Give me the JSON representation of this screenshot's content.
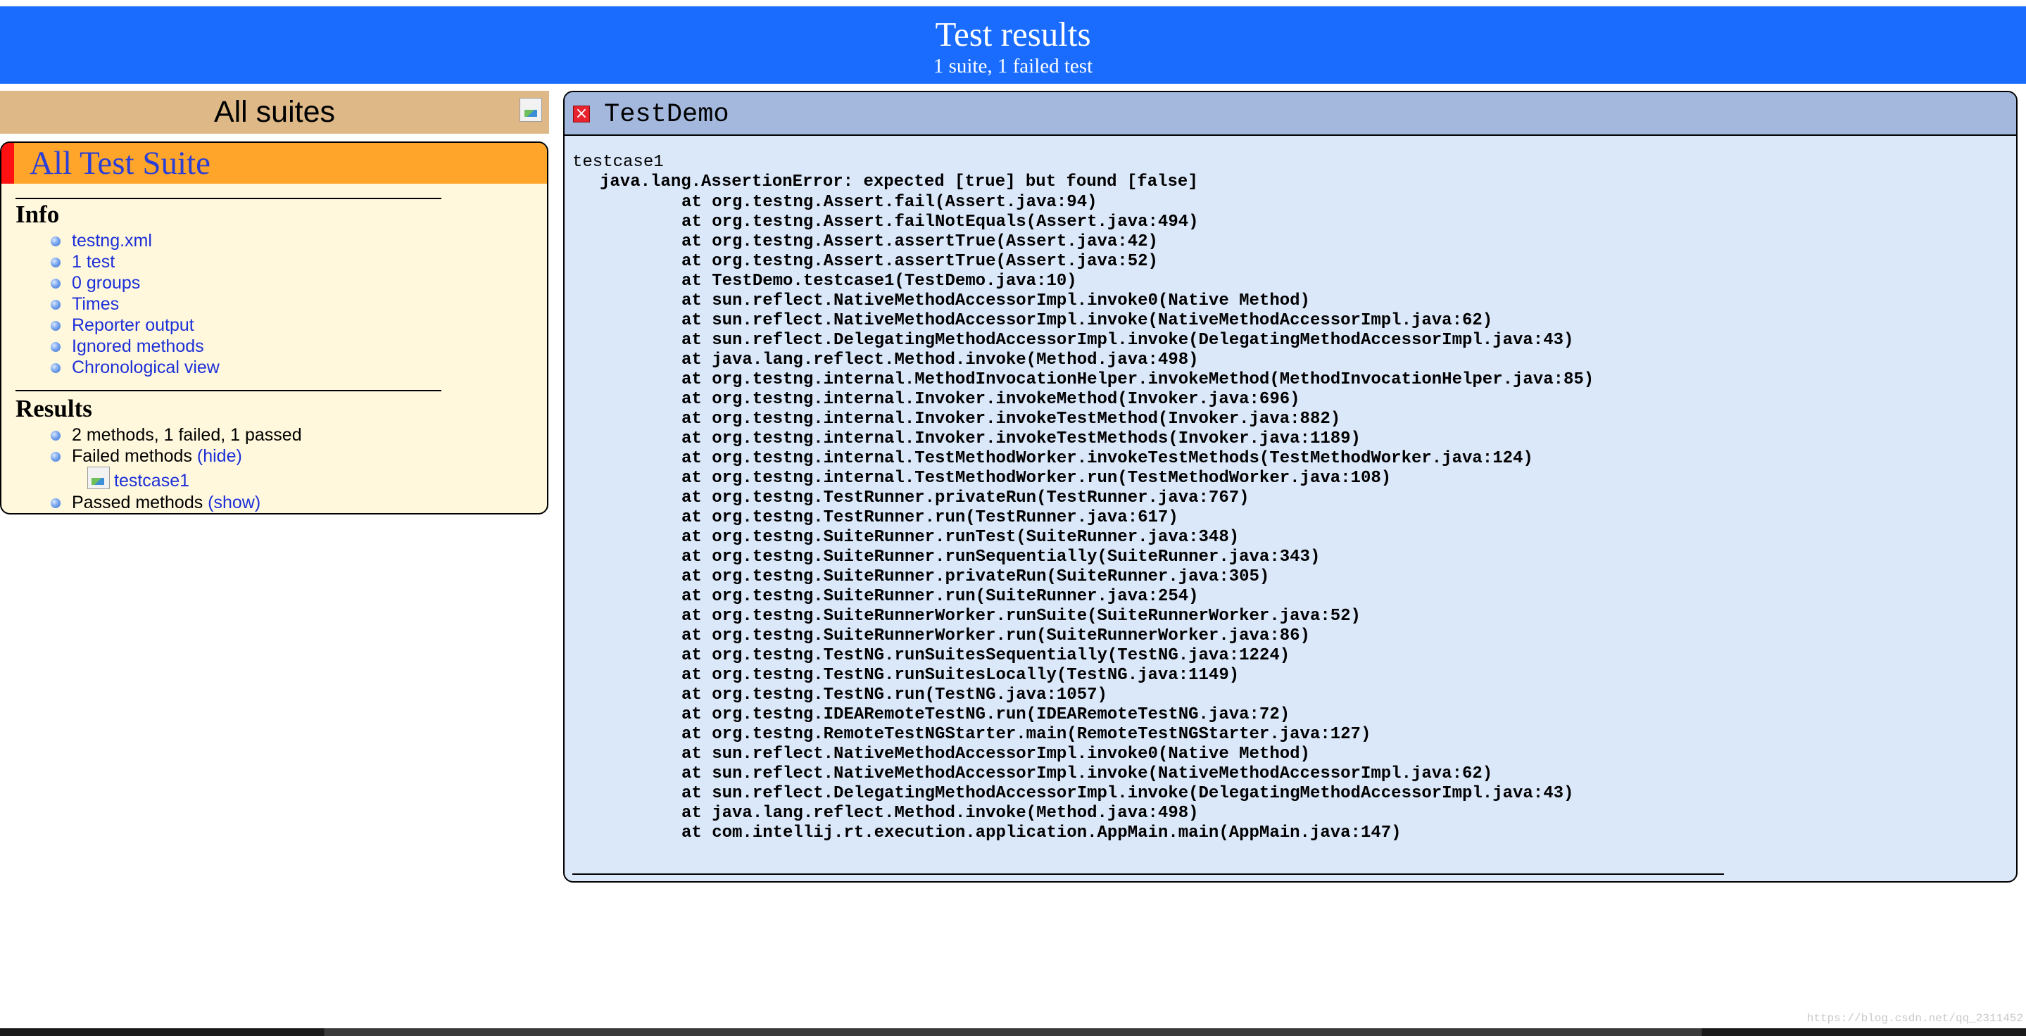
{
  "header": {
    "title": "Test results",
    "subtitle": "1 suite, 1 failed test"
  },
  "sidebar": {
    "all_suites_label": "All suites",
    "suite_name": "All Test Suite",
    "info": {
      "title": "Info",
      "links": [
        "testng.xml",
        "1 test",
        "0 groups",
        "Times",
        "Reporter output",
        "Ignored methods",
        "Chronological view"
      ]
    },
    "results": {
      "title": "Results",
      "summary": "2 methods, 1 failed, 1 passed",
      "failed_label": "Failed methods",
      "failed_toggle": "(hide)",
      "failed_methods": [
        "testcase1"
      ],
      "passed_label": "Passed methods",
      "passed_toggle": "(show)"
    }
  },
  "main": {
    "class_name": "TestDemo",
    "status": "failed",
    "test_name": "testcase1",
    "exception": "java.lang.AssertionError: expected [true] but found [false]",
    "stack": [
      "at org.testng.Assert.fail(Assert.java:94)",
      "at org.testng.Assert.failNotEquals(Assert.java:494)",
      "at org.testng.Assert.assertTrue(Assert.java:42)",
      "at org.testng.Assert.assertTrue(Assert.java:52)",
      "at TestDemo.testcase1(TestDemo.java:10)",
      "at sun.reflect.NativeMethodAccessorImpl.invoke0(Native Method)",
      "at sun.reflect.NativeMethodAccessorImpl.invoke(NativeMethodAccessorImpl.java:62)",
      "at sun.reflect.DelegatingMethodAccessorImpl.invoke(DelegatingMethodAccessorImpl.java:43)",
      "at java.lang.reflect.Method.invoke(Method.java:498)",
      "at org.testng.internal.MethodInvocationHelper.invokeMethod(MethodInvocationHelper.java:85)",
      "at org.testng.internal.Invoker.invokeMethod(Invoker.java:696)",
      "at org.testng.internal.Invoker.invokeTestMethod(Invoker.java:882)",
      "at org.testng.internal.Invoker.invokeTestMethods(Invoker.java:1189)",
      "at org.testng.internal.TestMethodWorker.invokeTestMethods(TestMethodWorker.java:124)",
      "at org.testng.internal.TestMethodWorker.run(TestMethodWorker.java:108)",
      "at org.testng.TestRunner.privateRun(TestRunner.java:767)",
      "at org.testng.TestRunner.run(TestRunner.java:617)",
      "at org.testng.SuiteRunner.runTest(SuiteRunner.java:348)",
      "at org.testng.SuiteRunner.runSequentially(SuiteRunner.java:343)",
      "at org.testng.SuiteRunner.privateRun(SuiteRunner.java:305)",
      "at org.testng.SuiteRunner.run(SuiteRunner.java:254)",
      "at org.testng.SuiteRunnerWorker.runSuite(SuiteRunnerWorker.java:52)",
      "at org.testng.SuiteRunnerWorker.run(SuiteRunnerWorker.java:86)",
      "at org.testng.TestNG.runSuitesSequentially(TestNG.java:1224)",
      "at org.testng.TestNG.runSuitesLocally(TestNG.java:1149)",
      "at org.testng.TestNG.run(TestNG.java:1057)",
      "at org.testng.IDEARemoteTestNG.run(IDEARemoteTestNG.java:72)",
      "at org.testng.RemoteTestNGStarter.main(RemoteTestNGStarter.java:127)",
      "at sun.reflect.NativeMethodAccessorImpl.invoke0(Native Method)",
      "at sun.reflect.NativeMethodAccessorImpl.invoke(NativeMethodAccessorImpl.java:62)",
      "at sun.reflect.DelegatingMethodAccessorImpl.invoke(DelegatingMethodAccessorImpl.java:43)",
      "at java.lang.reflect.Method.invoke(Method.java:498)",
      "at com.intellij.rt.execution.application.AppMain.main(AppMain.java:147)"
    ]
  },
  "watermark": "https://blog.csdn.net/qq_2311452",
  "colors": {
    "header_bg": "#1a6cff",
    "all_suites_bg": "#deb887",
    "suite_header_bg": "#ffa62a",
    "suite_fail_marker": "#ff1111",
    "suite_panel_bg": "#fff8dc",
    "main_header_bg": "#a3b8dc",
    "main_panel_bg": "#dbe8fa",
    "link": "#1c2fd8"
  },
  "icons": {
    "fail_status": "failed-x-icon",
    "broken_image": "broken-image-icon",
    "bullet": "bullet-icon"
  }
}
